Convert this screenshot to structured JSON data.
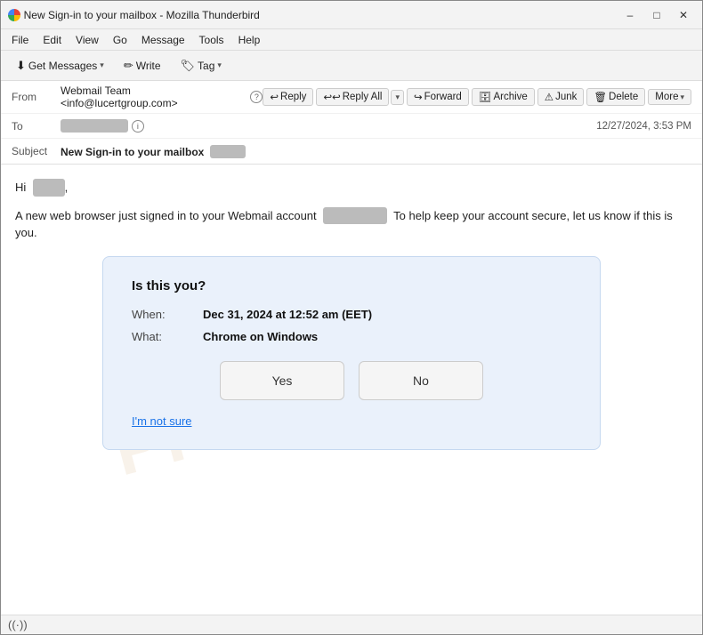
{
  "window": {
    "title": "New Sign-in to your mailbox - Mozilla Thunderbird",
    "controls": {
      "minimize": "–",
      "maximize": "□",
      "close": "✕"
    }
  },
  "menubar": {
    "items": [
      "File",
      "Edit",
      "View",
      "Go",
      "Message",
      "Tools",
      "Help"
    ]
  },
  "toolbar": {
    "get_messages": "Get Messages",
    "write": "Write",
    "tag": "Tag"
  },
  "email_header": {
    "from_label": "From",
    "from_value": "Webmail Team <info@lucertgroup.com>",
    "to_label": "To",
    "to_blurred": "██████████████",
    "subject_label": "Subject",
    "subject_value": "New Sign-in to your mailbox",
    "subject_blurred": "████████",
    "timestamp": "12/27/2024, 3:53 PM",
    "actions": {
      "reply": "Reply",
      "reply_all": "Reply All",
      "forward": "Forward",
      "archive": "Archive",
      "junk": "Junk",
      "delete": "Delete",
      "more": "More"
    }
  },
  "email_body": {
    "greeting_start": "Hi",
    "greeting_blurred": "██████████",
    "paragraph": "A new web browser just signed in to your Webmail account",
    "paragraph_blurred": "████████████████",
    "paragraph_end": "To help keep your account secure, let us know if this is you."
  },
  "security_card": {
    "question": "Is this you?",
    "when_label": "When:",
    "when_value": "Dec 31, 2024 at 12:52 am (EET)",
    "what_label": "What:",
    "what_value": "Chrome on Windows",
    "yes_btn": "Yes",
    "no_btn": "No",
    "not_sure": "I'm not sure"
  },
  "status_bar": {
    "icon": "((·))"
  }
}
